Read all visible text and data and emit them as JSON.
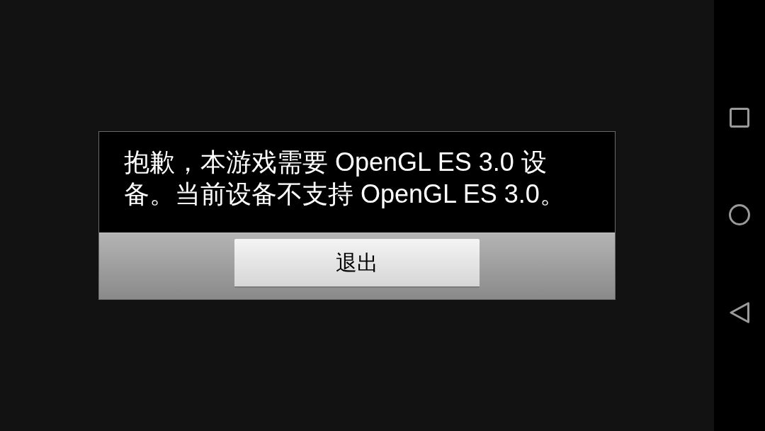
{
  "dialog": {
    "message": "抱歉，本游戏需要 OpenGL ES 3.0 设备。当前设备不支持 OpenGL ES 3.0。",
    "buttons": [
      {
        "label": "退出"
      }
    ]
  }
}
